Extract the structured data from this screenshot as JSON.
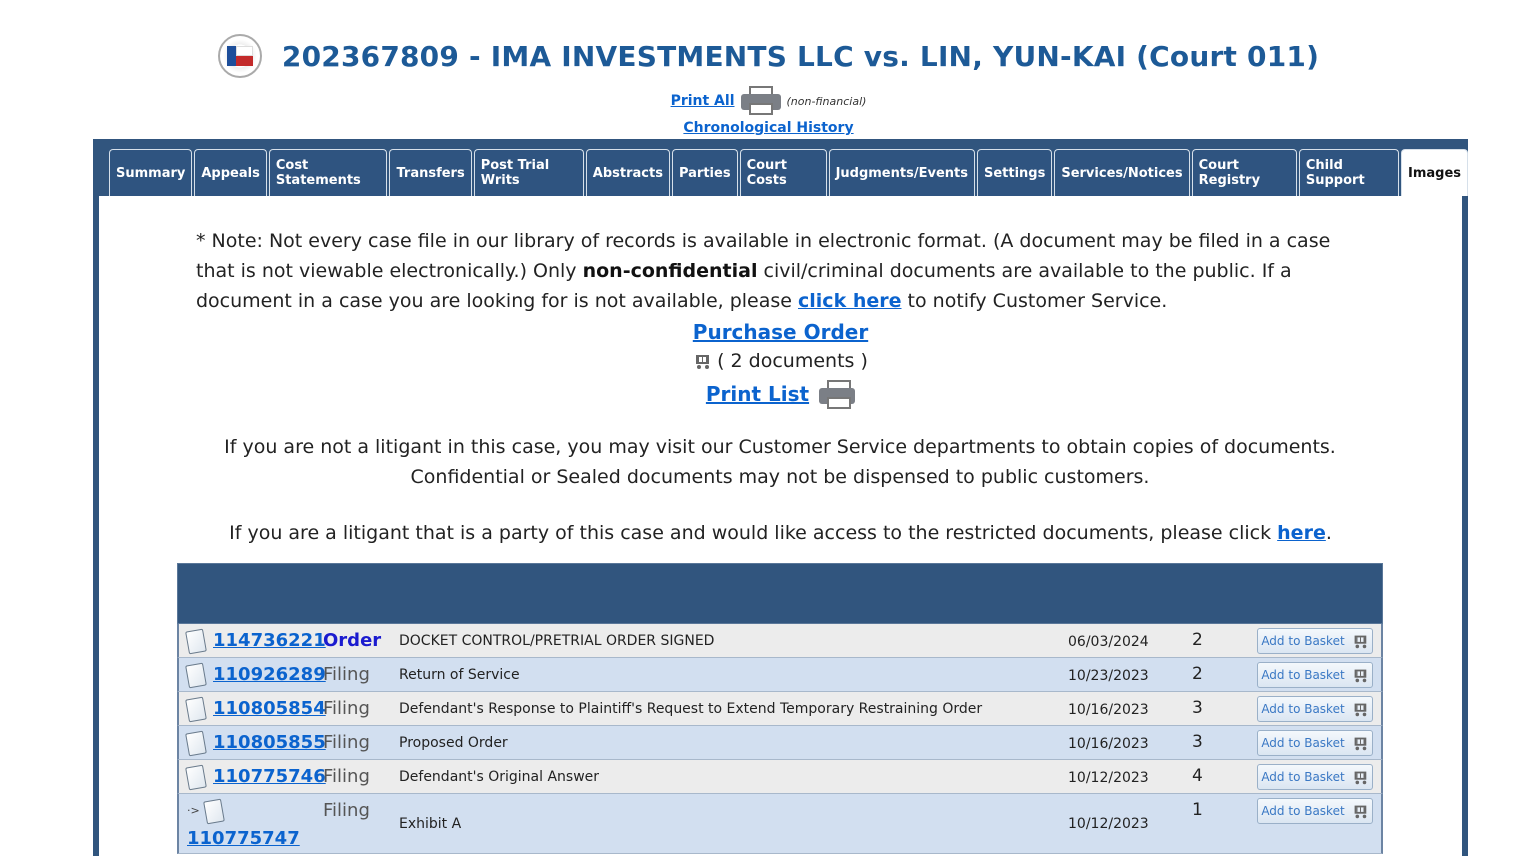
{
  "header": {
    "title": "202367809 - IMA INVESTMENTS LLC vs. LIN, YUN-KAI (Court 011)",
    "print_all": "Print All",
    "non_financial": "(non-financial)",
    "chronological_history": "Chronological History"
  },
  "tabs": [
    {
      "label": "Summary"
    },
    {
      "label": "Appeals"
    },
    {
      "label": "Cost Statements"
    },
    {
      "label": "Transfers"
    },
    {
      "label": "Post Trial Writs"
    },
    {
      "label": "Abstracts"
    },
    {
      "label": "Parties"
    },
    {
      "label": "Court Costs"
    },
    {
      "label": "Judgments/Events"
    },
    {
      "label": "Settings"
    },
    {
      "label": "Services/Notices"
    },
    {
      "label": "Court Registry"
    },
    {
      "label": "Child Support"
    },
    {
      "label": "Images",
      "active": true
    }
  ],
  "note": {
    "part1": "* Note: Not every case file in our library of records is available in electronic format. (A document may be filed in a case that is not viewable electronically.) Only ",
    "bold": "non-confidential",
    "part2": " civil/criminal documents are available to the public. If a document in a case you are looking for is not available, please ",
    "link": "click here",
    "part3": " to notify Customer Service."
  },
  "purchase_order": "Purchase Order",
  "documents_count": "( 2 documents )",
  "print_list": "Print List",
  "info_non_litigant": "If you are not a litigant in this case, you may visit our Customer Service departments to obtain copies of documents. Confidential or Sealed documents may not be dispensed to public customers.",
  "info_litigant": {
    "text": "If you are a litigant that is a party of this case and would like access to the restricted documents, please click ",
    "link": "here",
    "end": "."
  },
  "add_to_basket_label": "Add to Basket",
  "documents": [
    {
      "number": "114736221",
      "type": "Order",
      "description": "DOCKET CONTROL/PRETRIAL ORDER SIGNED",
      "date": "06/03/2024",
      "pages": "2"
    },
    {
      "number": "110926289",
      "type": "Filing",
      "description": "Return of Service",
      "date": "10/23/2023",
      "pages": "2"
    },
    {
      "number": "110805854",
      "type": "Filing",
      "description": "Defendant's Response to Plaintiff's Request to Extend Temporary Restraining Order",
      "date": "10/16/2023",
      "pages": "3"
    },
    {
      "number": "110805855",
      "type": "Filing",
      "description": "Proposed Order",
      "date": "10/16/2023",
      "pages": "3"
    },
    {
      "number": "110775746",
      "type": "Filing",
      "description": "Defendant's Original Answer",
      "date": "10/12/2023",
      "pages": "4"
    },
    {
      "number": "110775747",
      "type": "Filing",
      "description": "Exhibit A",
      "date": "10/12/2023",
      "pages": "1",
      "arrow": "·>"
    }
  ]
}
